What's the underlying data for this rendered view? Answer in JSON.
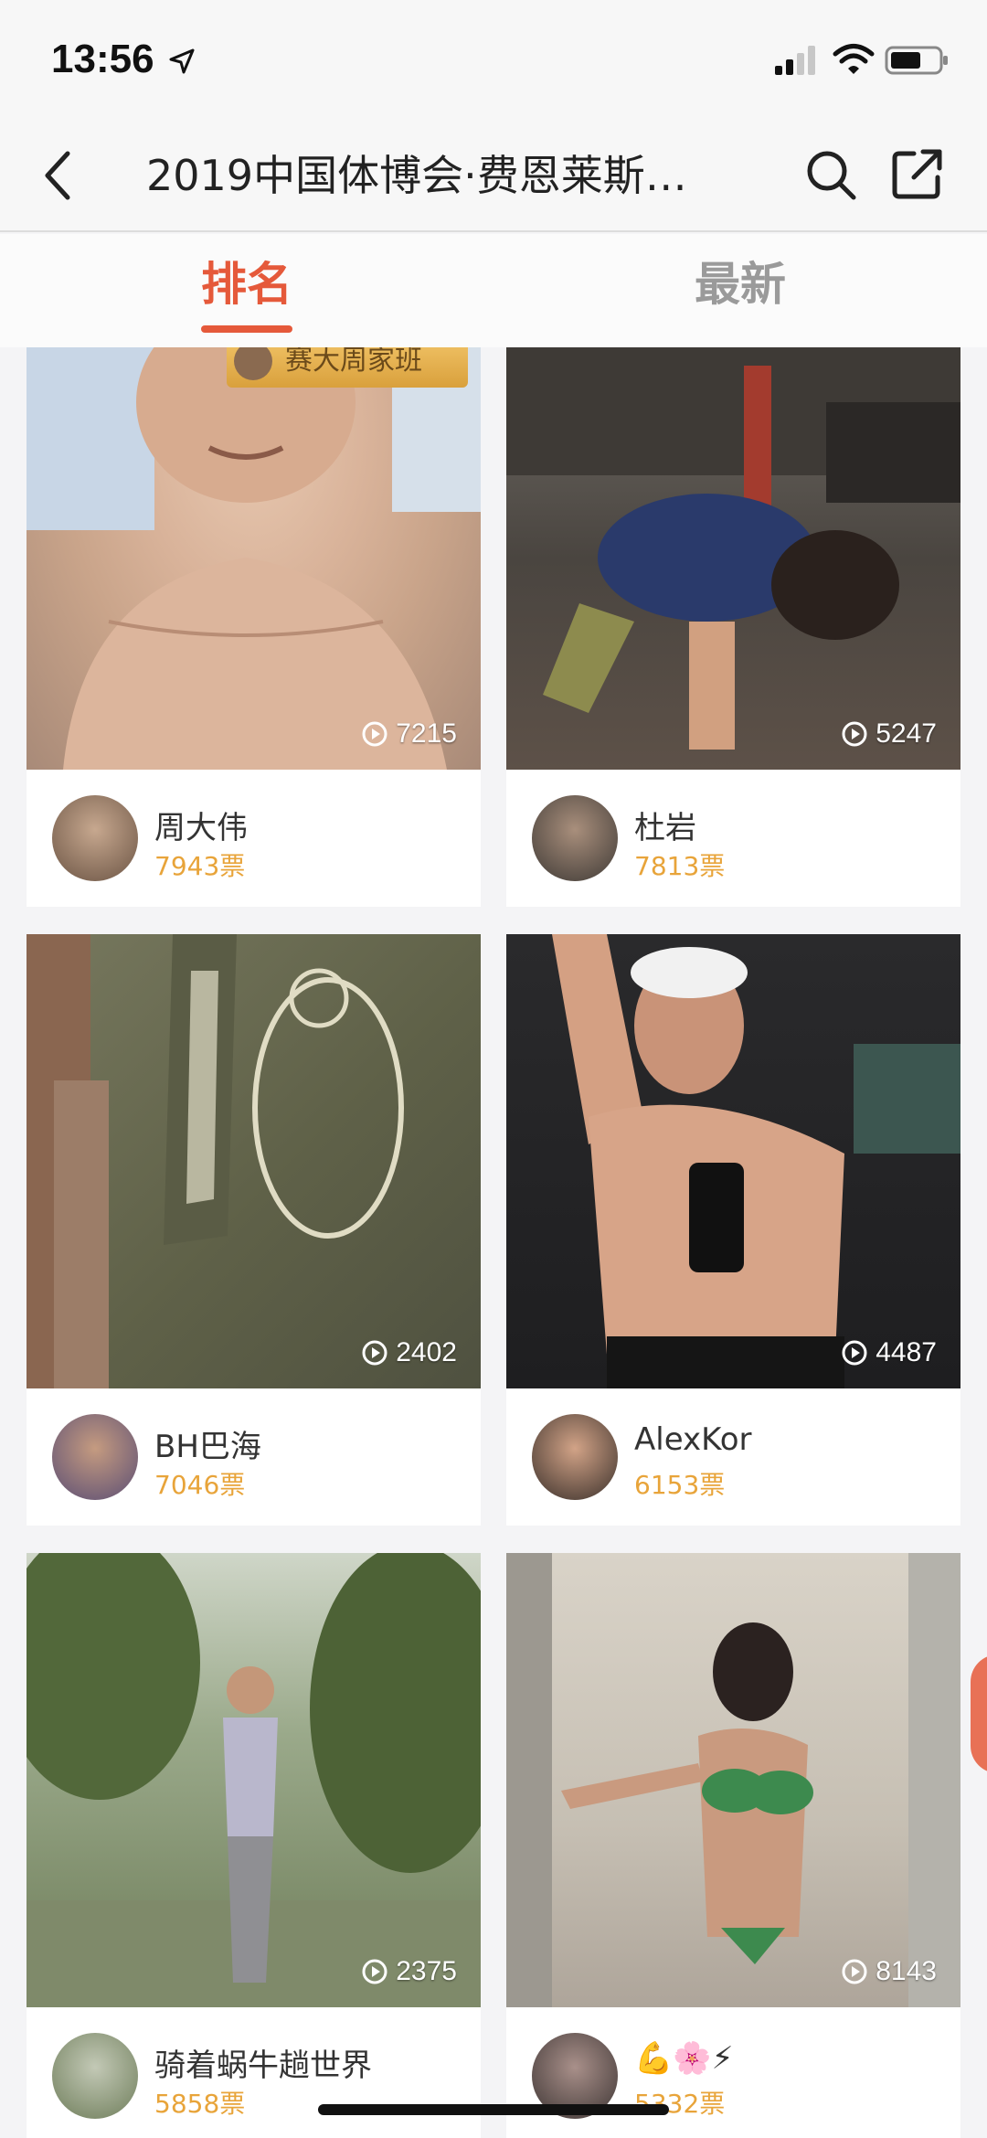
{
  "status_bar": {
    "time": "13:56"
  },
  "nav": {
    "title": "2019中国体博会·费恩莱斯…"
  },
  "tabs": [
    {
      "label": "排名",
      "active": true
    },
    {
      "label": "最新",
      "active": false
    }
  ],
  "badge": {
    "label": "赛大周家班"
  },
  "cards": [
    {
      "name": "周大伟",
      "votes": "7943票",
      "views": "7215"
    },
    {
      "name": "杜岩",
      "votes": "7813票",
      "views": "5247"
    },
    {
      "name": "BH巴海",
      "votes": "7046票",
      "views": "2402"
    },
    {
      "name": "AlexKor",
      "votes": "6153票",
      "views": "4487"
    },
    {
      "name": "骑着蜗牛趟世界",
      "votes": "5858票",
      "views": "2375"
    },
    {
      "name": "💪🌸⚡",
      "votes": "5332票",
      "views": "8143"
    }
  ],
  "colors": {
    "accent": "#e5593a",
    "votes": "#e8a43a",
    "inactive_tab": "#9a9a9a"
  }
}
